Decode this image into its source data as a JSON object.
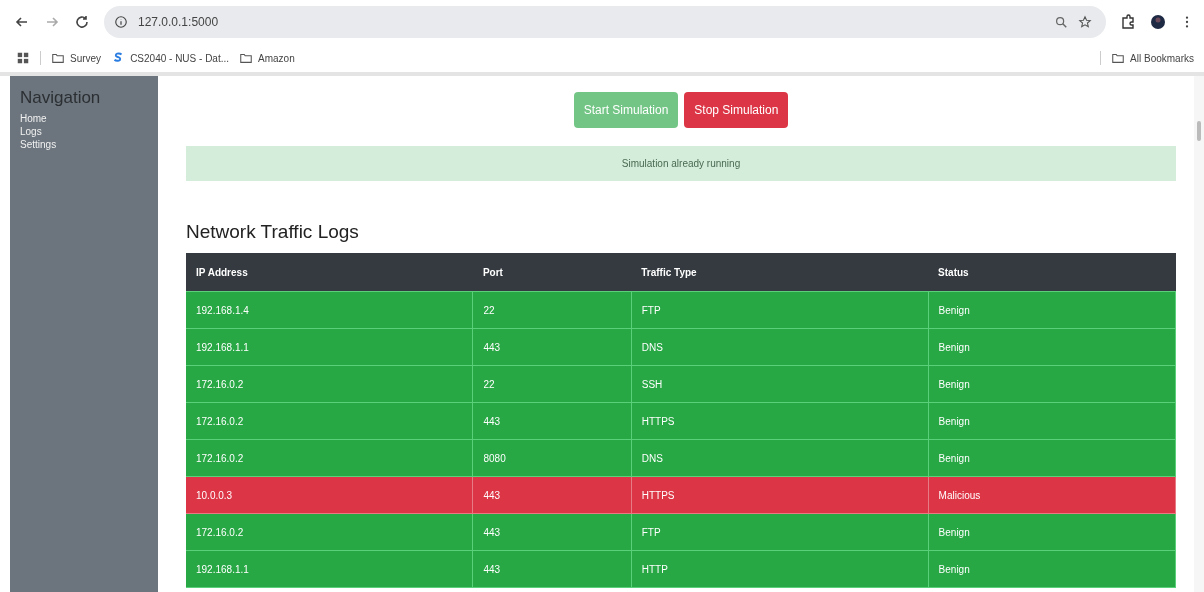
{
  "browser": {
    "address": "127.0.0.1:5000",
    "bookmarks": [
      {
        "kind": "folder",
        "label": "Survey"
      },
      {
        "kind": "site",
        "label": "CS2040 - NUS - Dat..."
      },
      {
        "kind": "folder",
        "label": "Amazon"
      }
    ],
    "all_bookmarks": "All Bookmarks"
  },
  "sidebar": {
    "title": "Navigation",
    "items": [
      "Home",
      "Logs",
      "Settings"
    ]
  },
  "buttons": [
    {
      "label": "Start Simulation",
      "kind": "start",
      "disabled": true
    },
    {
      "label": "Stop Simulation",
      "kind": "stop",
      "disabled": false
    }
  ],
  "alert": "Simulation already running",
  "heading": "Network Traffic Logs",
  "table": {
    "columns": [
      "IP Address",
      "Port",
      "Traffic Type",
      "Status"
    ],
    "rows": [
      {
        "cells": [
          "192.168.1.4",
          "22",
          "FTP",
          "Benign"
        ],
        "malicious": false
      },
      {
        "cells": [
          "192.168.1.1",
          "443",
          "DNS",
          "Benign"
        ],
        "malicious": false
      },
      {
        "cells": [
          "172.16.0.2",
          "22",
          "SSH",
          "Benign"
        ],
        "malicious": false
      },
      {
        "cells": [
          "172.16.0.2",
          "443",
          "HTTPS",
          "Benign"
        ],
        "malicious": false
      },
      {
        "cells": [
          "172.16.0.2",
          "8080",
          "DNS",
          "Benign"
        ],
        "malicious": false
      },
      {
        "cells": [
          "10.0.0.3",
          "443",
          "HTTPS",
          "Malicious"
        ],
        "malicious": true
      },
      {
        "cells": [
          "172.16.0.2",
          "443",
          "FTP",
          "Benign"
        ],
        "malicious": false
      },
      {
        "cells": [
          "192.168.1.1",
          "443",
          "HTTP",
          "Benign"
        ],
        "malicious": false
      }
    ]
  }
}
